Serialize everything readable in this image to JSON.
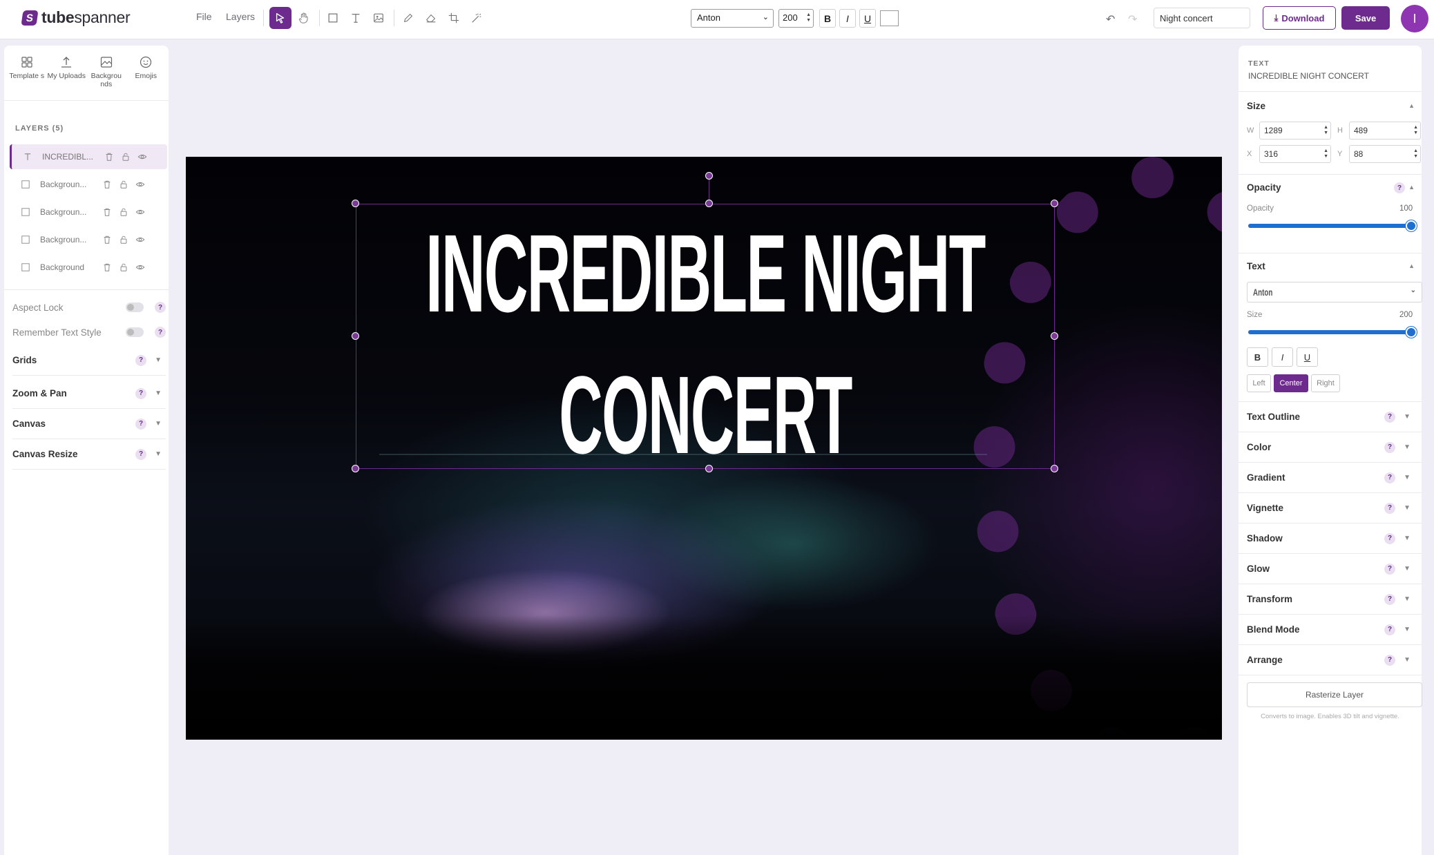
{
  "app": {
    "logo_text_bold": "tube",
    "logo_text_rest": "spanner",
    "logo_mark": "S",
    "brand_color": "#6d2c8d"
  },
  "topbar": {
    "menu": [
      "File",
      "Layers"
    ],
    "tools": [
      "select-icon",
      "hand-icon",
      "rectangle-icon",
      "text-icon",
      "image-icon",
      "pen-icon",
      "eraser-icon",
      "crop-icon",
      "magic-wand-icon"
    ],
    "font": "Anton",
    "font_size": "200",
    "bold": "B",
    "italic": "I",
    "underline": "U",
    "project_title": "Night concert",
    "download_label": "Download",
    "save_label": "Save",
    "avatar_initial": "I"
  },
  "left": {
    "tabs": [
      {
        "icon": "templates-icon",
        "label": "Template s"
      },
      {
        "icon": "upload-icon",
        "label": "My Uploads"
      },
      {
        "icon": "backgrounds-icon",
        "label": "Backgrou nds"
      },
      {
        "icon": "emoji-icon",
        "label": "Emojis"
      }
    ],
    "layers_title": "LAYERS (5)",
    "layers": [
      {
        "type": "text",
        "label": "INCREDIBL...",
        "selected": true
      },
      {
        "type": "image",
        "label": "Backgroun..."
      },
      {
        "type": "image",
        "label": "Backgroun..."
      },
      {
        "type": "image",
        "label": "Backgroun..."
      },
      {
        "type": "image",
        "label": "Background"
      }
    ],
    "aspect_lock": "Aspect Lock",
    "remember_text_style": "Remember Text Style",
    "sections": [
      "Grids",
      "Zoom & Pan",
      "Canvas",
      "Canvas Resize"
    ],
    "help": "?"
  },
  "canvas": {
    "line1": "INCREDIBLE NIGHT",
    "line2": "CONCERT"
  },
  "right": {
    "kind": "TEXT",
    "name": "INCREDIBLE NIGHT CONCERT",
    "size_title": "Size",
    "w_label": "W",
    "w": "1289",
    "h_label": "H",
    "h": "489",
    "x_label": "X",
    "x": "316",
    "y_label": "Y",
    "y": "88",
    "opacity_title": "Opacity",
    "opacity_label": "Opacity",
    "opacity_value": "100",
    "opacity_fraction": 1.0,
    "text_title": "Text",
    "font": "Anton",
    "size_label": "Size",
    "size_value": "200",
    "size_fraction": 1.0,
    "align": [
      "Left",
      "Center",
      "Right"
    ],
    "align_active": "Center",
    "sections": [
      "Text Outline",
      "Color",
      "Gradient",
      "Vignette",
      "Shadow",
      "Glow",
      "Transform",
      "Blend Mode",
      "Arrange"
    ],
    "rasterize_label": "Rasterize Layer",
    "rasterize_note": "Converts to image. Enables 3D tilt and vignette."
  }
}
